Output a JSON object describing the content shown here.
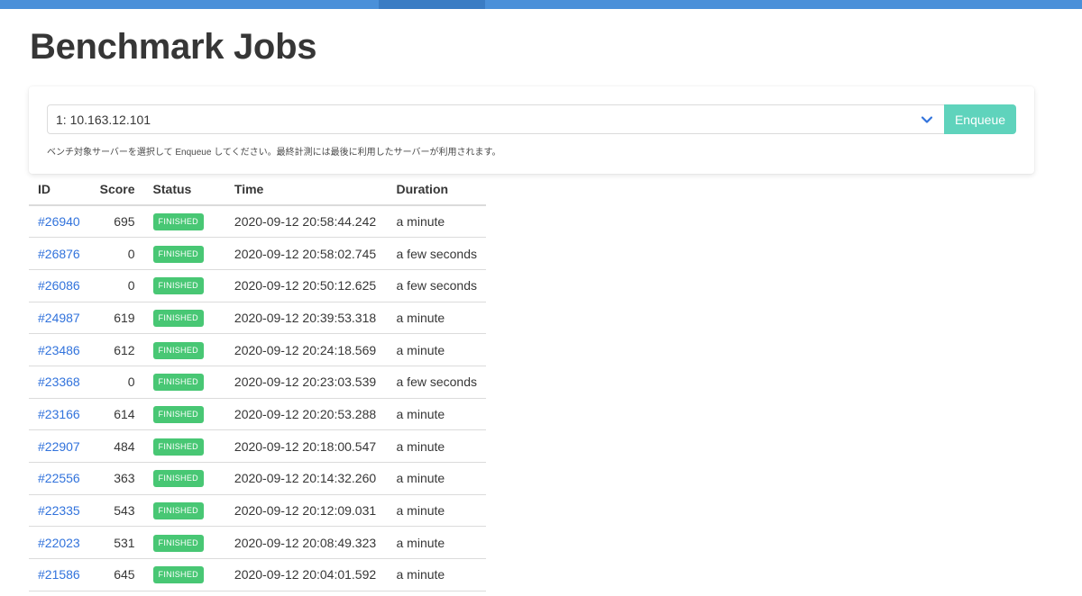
{
  "page": {
    "title": "Benchmark Jobs"
  },
  "enqueue": {
    "selected_server": "1: 10.163.12.101",
    "button_label": "Enqueue",
    "help_text": "ベンチ対象サーバーを選択して Enqueue してください。最終計測には最後に利用したサーバーが利用されます。"
  },
  "table": {
    "headers": [
      "ID",
      "Score",
      "Status",
      "Time",
      "Duration"
    ],
    "rows": [
      {
        "id": "#26940",
        "score": "695",
        "status": "FINISHED",
        "time": "2020-09-12 20:58:44.242",
        "duration": "a minute"
      },
      {
        "id": "#26876",
        "score": "0",
        "status": "FINISHED",
        "time": "2020-09-12 20:58:02.745",
        "duration": "a few seconds"
      },
      {
        "id": "#26086",
        "score": "0",
        "status": "FINISHED",
        "time": "2020-09-12 20:50:12.625",
        "duration": "a few seconds"
      },
      {
        "id": "#24987",
        "score": "619",
        "status": "FINISHED",
        "time": "2020-09-12 20:39:53.318",
        "duration": "a minute"
      },
      {
        "id": "#23486",
        "score": "612",
        "status": "FINISHED",
        "time": "2020-09-12 20:24:18.569",
        "duration": "a minute"
      },
      {
        "id": "#23368",
        "score": "0",
        "status": "FINISHED",
        "time": "2020-09-12 20:23:03.539",
        "duration": "a few seconds"
      },
      {
        "id": "#23166",
        "score": "614",
        "status": "FINISHED",
        "time": "2020-09-12 20:20:53.288",
        "duration": "a minute"
      },
      {
        "id": "#22907",
        "score": "484",
        "status": "FINISHED",
        "time": "2020-09-12 20:18:00.547",
        "duration": "a minute"
      },
      {
        "id": "#22556",
        "score": "363",
        "status": "FINISHED",
        "time": "2020-09-12 20:14:32.260",
        "duration": "a minute"
      },
      {
        "id": "#22335",
        "score": "543",
        "status": "FINISHED",
        "time": "2020-09-12 20:12:09.031",
        "duration": "a minute"
      },
      {
        "id": "#22023",
        "score": "531",
        "status": "FINISHED",
        "time": "2020-09-12 20:08:49.323",
        "duration": "a minute"
      },
      {
        "id": "#21586",
        "score": "645",
        "status": "FINISHED",
        "time": "2020-09-12 20:04:01.592",
        "duration": "a minute"
      }
    ]
  },
  "colors": {
    "topbar": "#4a90d9",
    "link": "#3273dc",
    "status_finished": "#48c774",
    "enqueue_button": "#5fd3bc",
    "chevron": "#3273dc"
  },
  "icons": {
    "select_arrow": "chevron-down-icon"
  }
}
